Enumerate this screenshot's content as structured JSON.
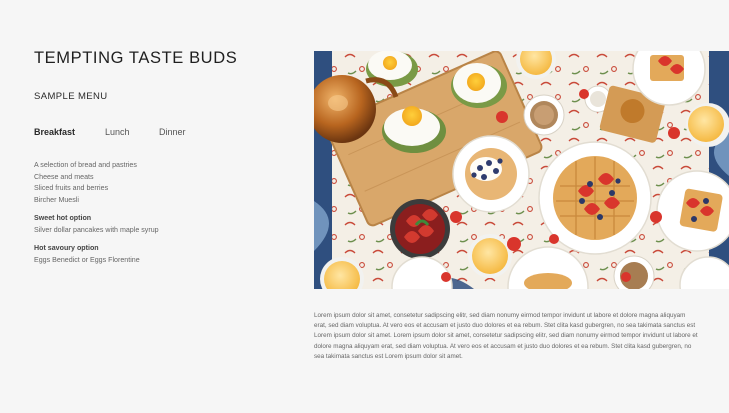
{
  "header": {
    "title": "TEMPTING TASTE BUDS",
    "subtitle": "SAMPLE MENU"
  },
  "tabs": [
    {
      "label": "Breakfast",
      "active": true
    },
    {
      "label": "Lunch",
      "active": false
    },
    {
      "label": "Dinner",
      "active": false
    }
  ],
  "menu": {
    "intro": [
      "A selection of bread and pastries",
      "Cheese and meats",
      "Sliced fruits and berries",
      "Bircher Muesli"
    ],
    "sweet": {
      "heading": "Sweet hot option",
      "text": "Silver dollar pancakes with maple syrup"
    },
    "savoury": {
      "heading": "Hot savoury option",
      "text": "Eggs Benedict or Eggs Florentine"
    }
  },
  "photo": {
    "icon": "breakfast-table-photo"
  },
  "description": "Lorem ipsum dolor sit amet, consetetur sadipscing elitr, sed diam nonumy eirmod tempor invidunt ut labore et dolore magna aliquyam erat, sed diam voluptua. At vero eos et accusam et justo duo dolores et ea rebum. Stet clita kasd gubergren, no sea takimata sanctus est Lorem ipsum dolor sit amet. Lorem ipsum dolor sit amet, consetetur sadipscing elitr, sed diam nonumy eirmod tempor invidunt ut labore et dolore magna aliquyam erat, sed diam voluptua. At vero eos et accusam et justo duo dolores et ea rebum. Stet clita kasd gubergren, no sea takimata sanctus est Lorem ipsum dolor sit amet.",
  "colors": {
    "background": "#f6f6f6",
    "text": "#3b3b3b",
    "tablecloth": "#f4efe6",
    "tablecloth_pattern": "#2f4f7f"
  }
}
